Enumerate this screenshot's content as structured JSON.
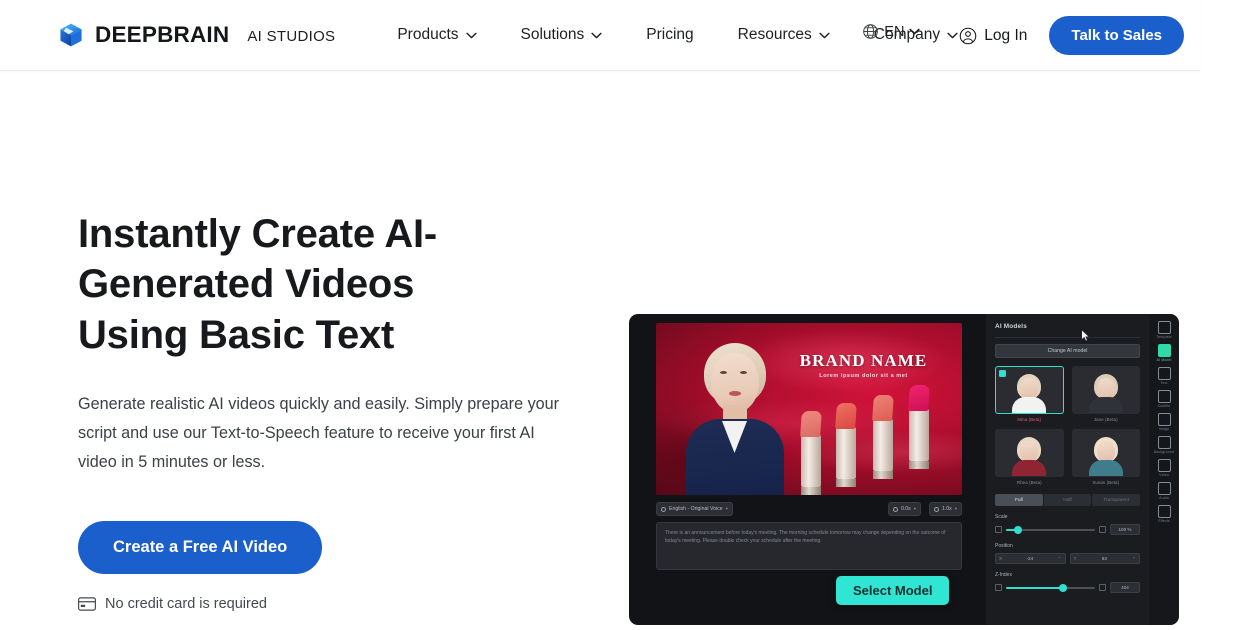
{
  "header": {
    "brand": {
      "name": "DEEPBRAIN",
      "sub": "AI STUDIOS",
      "logo_icon": "cube-logo-icon"
    },
    "nav": [
      {
        "label": "Products",
        "has_dropdown": true,
        "icon": "chevron-down-icon"
      },
      {
        "label": "Solutions",
        "has_dropdown": true,
        "icon": "chevron-down-icon"
      },
      {
        "label": "Pricing",
        "has_dropdown": false,
        "icon": ""
      },
      {
        "label": "Resources",
        "has_dropdown": true,
        "icon": "chevron-down-icon"
      },
      {
        "label": "Company",
        "has_dropdown": true,
        "icon": "chevron-down-icon"
      }
    ],
    "language": {
      "label": "EN",
      "icon": "globe-icon",
      "chevron": "chevron-down-icon"
    },
    "login": {
      "label": "Log In",
      "icon": "user-circle-icon"
    },
    "cta": {
      "label": "Talk to Sales"
    }
  },
  "hero": {
    "headline": "Instantly Create AI-Generated Videos Using Basic Text",
    "subcopy": "Generate realistic AI videos quickly and easily. Simply prepare your script and use our Text-to-Speech feature to receive your first AI video in 5 minutes or less.",
    "cta": {
      "label": "Create a Free AI Video"
    },
    "note": {
      "label": "No credit card is required",
      "icon": "credit-card-icon"
    }
  },
  "mock": {
    "stage": {
      "brand_title": "BRAND NAME",
      "brand_subtitle": "Lorem ipsum dolor sit a met"
    },
    "voice_chip": {
      "label": "English - Original Voice",
      "icon": "voice-icon",
      "caret": "caret-down-icon"
    },
    "time_chip": {
      "label": "0.0s",
      "icon": "clock-icon",
      "caret": "caret-down-icon"
    },
    "speed_chip": {
      "label": "1.0x",
      "icon": "speed-icon",
      "caret": "caret-down-icon"
    },
    "script": "There is an announcement before today's meeting. The morning schedule tomorrow may change depending on the outcome of today's meeting. Please double check your schedule after the meeting.",
    "tooltip": {
      "label": "Select Model"
    },
    "panel": {
      "title": "AI Models",
      "change_button": "Change AI model",
      "models": [
        {
          "name": "Mina (Beta)",
          "selected": true,
          "hair": "#e4d4be",
          "body": "#f2f2f0",
          "label_color": "#d8626f"
        },
        {
          "name": "Jane (Beta)",
          "selected": false,
          "hair": "#ddcdb6",
          "body": "#2f3238",
          "label_color": "#8a8f96"
        },
        {
          "name": "Rhea (Beta)",
          "selected": false,
          "hair": "#e9d9c2",
          "body": "#8f2433",
          "label_color": "#8a8f96"
        },
        {
          "name": "Susan (Beta)",
          "selected": false,
          "hair": "#efe0cb",
          "body": "#3f7d8c",
          "label_color": "#8a8f96"
        }
      ],
      "tabs": [
        {
          "label": "Full",
          "active": true
        },
        {
          "label": "Half",
          "active": false
        },
        {
          "label": "Transparent",
          "active": false
        }
      ],
      "scale": {
        "label": "Scale",
        "value": "100 %",
        "fill_pct": 12
      },
      "position": {
        "label": "Position",
        "x_key": "X",
        "x_value": "-24",
        "y_key": "Y",
        "y_value": "63"
      },
      "zindex": {
        "label": "Z-Index",
        "value": "404",
        "fill_pct": 62
      }
    },
    "rail": [
      {
        "label": "Template",
        "icon": "template-icon",
        "active": false
      },
      {
        "label": "AI Model",
        "icon": "ai-model-icon",
        "active": true
      },
      {
        "label": "Text",
        "icon": "text-icon",
        "active": false
      },
      {
        "label": "Subtitle",
        "icon": "subtitle-icon",
        "active": false
      },
      {
        "label": "Image",
        "icon": "image-icon",
        "active": false
      },
      {
        "label": "Background",
        "icon": "background-icon",
        "active": false
      },
      {
        "label": "Video",
        "icon": "video-icon",
        "active": false
      },
      {
        "label": "Audio",
        "icon": "audio-icon",
        "active": false
      },
      {
        "label": "Effects",
        "icon": "effects-icon",
        "active": false
      }
    ]
  },
  "colors": {
    "brand_blue": "#1a5fcc",
    "accent_teal": "#31e5d4",
    "text_dark": "#18191c",
    "text_body": "#3c4047",
    "app_bg": "#121316"
  }
}
